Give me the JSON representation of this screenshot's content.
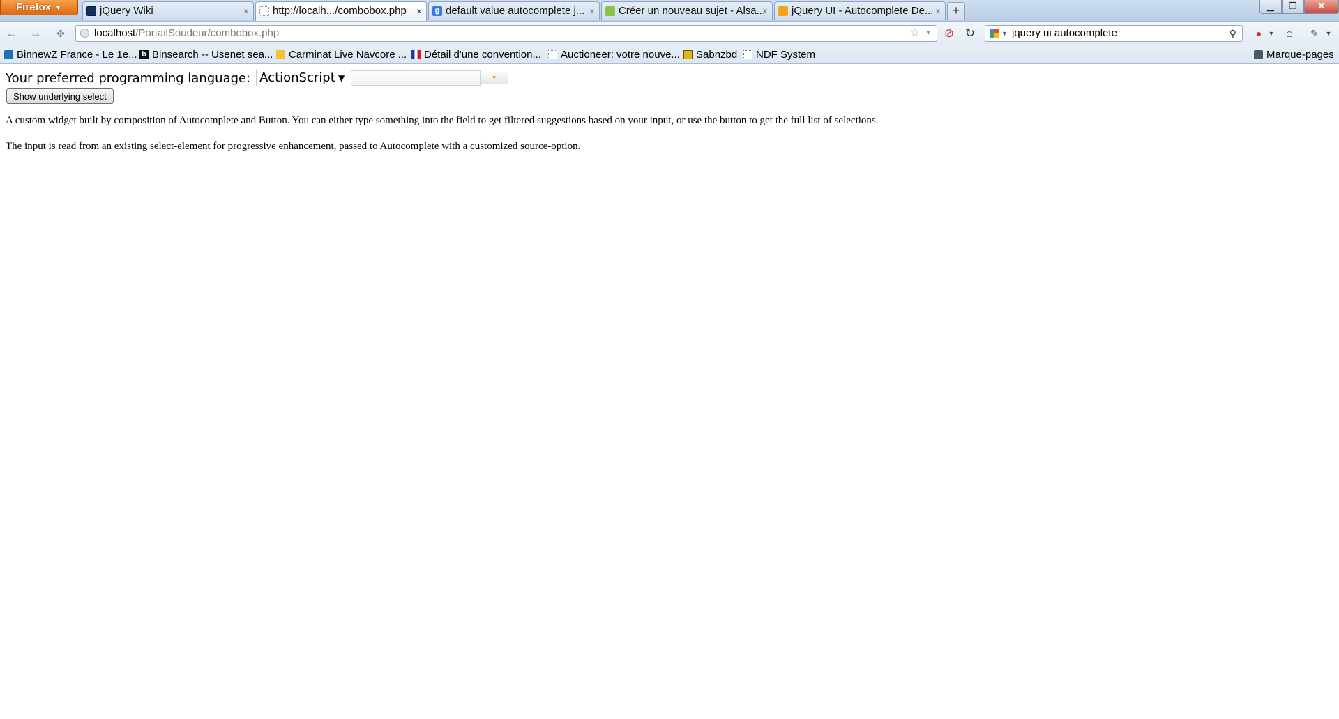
{
  "browser": {
    "menu_label": "Firefox",
    "tabs": [
      {
        "title": "jQuery Wiki",
        "favicon": "jquery-icon"
      },
      {
        "title": "http://localh.../combobox.php",
        "favicon": "blank-page-icon",
        "active": true
      },
      {
        "title": "default value autocomplete j...",
        "favicon": "google-icon"
      },
      {
        "title": "Créer un nouveau sujet - Alsa...",
        "favicon": "alsacreations-icon"
      },
      {
        "title": "jQuery UI - Autocomplete De...",
        "favicon": "jquery-ui-icon"
      }
    ],
    "new_tab_symbol": "+",
    "window_controls": {
      "minimize": "▁",
      "maximize": "❐",
      "close": "✕"
    }
  },
  "navigation": {
    "url_host": "localhost",
    "url_path": "/PortailSoudeur/combobox.php",
    "search_query": "jquery ui autocomplete"
  },
  "bookmarks": [
    {
      "label": "BinnewZ France - Le 1e...",
      "icon": "binnewz-icon"
    },
    {
      "label": "Binsearch -- Usenet sea...",
      "icon": "binsearch-icon"
    },
    {
      "label": "Carminat Live Navcore ...",
      "icon": "folder-icon"
    },
    {
      "label": "Détail d'une convention...",
      "icon": "french-flag-icon"
    },
    {
      "label": "Auctioneer: votre nouve...",
      "icon": "blank-page-icon"
    },
    {
      "label": "Sabnzbd",
      "icon": "sabnzbd-icon"
    },
    {
      "label": "NDF System",
      "icon": "blank-page-icon"
    }
  ],
  "bookmarks_menu_label": "Marque-pages",
  "page": {
    "language_label": "Your preferred programming language:",
    "selected_language": "ActionScript",
    "show_select_button": "Show underlying select",
    "description_1": "A custom widget built by composition of Autocomplete and Button. You can either type something into the field to get filtered suggestions based on your input, or use the button to get the full list of selections.",
    "description_2": "The input is read from an existing select-element for progressive enhancement, passed to Autocomplete with a customized source-option."
  }
}
